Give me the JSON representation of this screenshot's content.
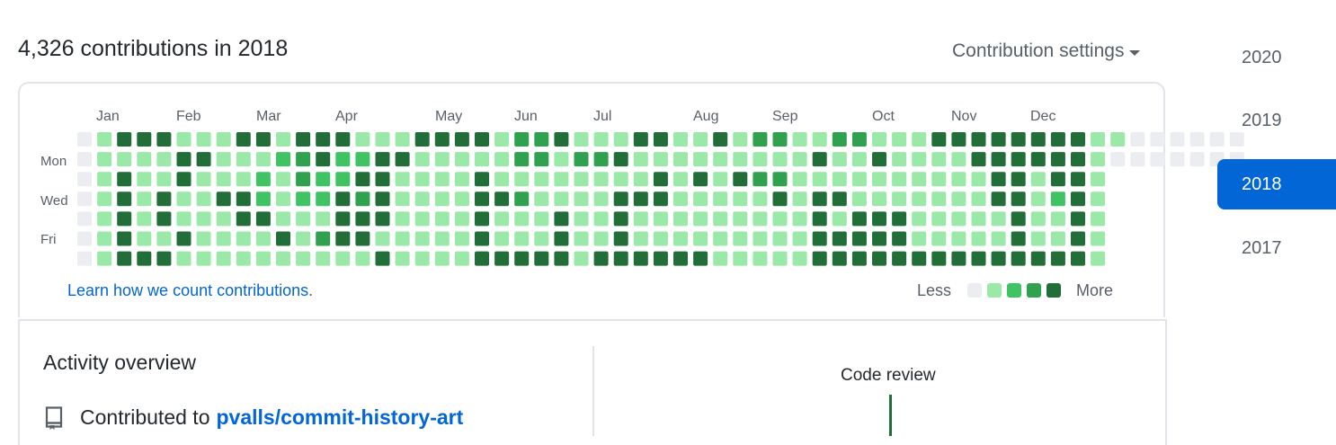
{
  "header": {
    "title": "4,326 contributions in 2018",
    "settings_label": "Contribution settings"
  },
  "calendar": {
    "months": [
      "Jan",
      "Feb",
      "Mar",
      "Apr",
      "May",
      "Jun",
      "Jul",
      "Aug",
      "Sep",
      "Oct",
      "Nov",
      "Dec"
    ],
    "day_labels": [
      "Mon",
      "Wed",
      "Fri"
    ],
    "learn_link": "Learn how we count contributions",
    "learn_period": ".",
    "legend_less": "Less",
    "legend_more": "More",
    "level_colors": [
      "#ebedf0",
      "#9be9a8",
      "#40c463",
      "#30a14e",
      "#216e39"
    ],
    "rows": [
      "01444111441444111444413341114411413311331114444444411000000",
      "01111441112342244111113313341111111114114111144444410000000",
      "01411411121322441111411111111414143311111111114414410000000",
      "01414114421224341111443111144411111414411111114412410000000",
      "01414111441114441111411141141111111114144411111411410000000",
      "01411411114134411111411141141111111114444411111411410000000",
      "01444111111111141111444441444444111114444444444444410000000"
    ]
  },
  "activity": {
    "title": "Activity overview",
    "contributed_to": "Contributed to",
    "repo": "pvalls/commit-history-art",
    "code_review": "Code review"
  },
  "years": [
    {
      "label": "2020",
      "active": false
    },
    {
      "label": "2019",
      "active": false
    },
    {
      "label": "2018",
      "active": true
    },
    {
      "label": "2017",
      "active": false
    }
  ]
}
